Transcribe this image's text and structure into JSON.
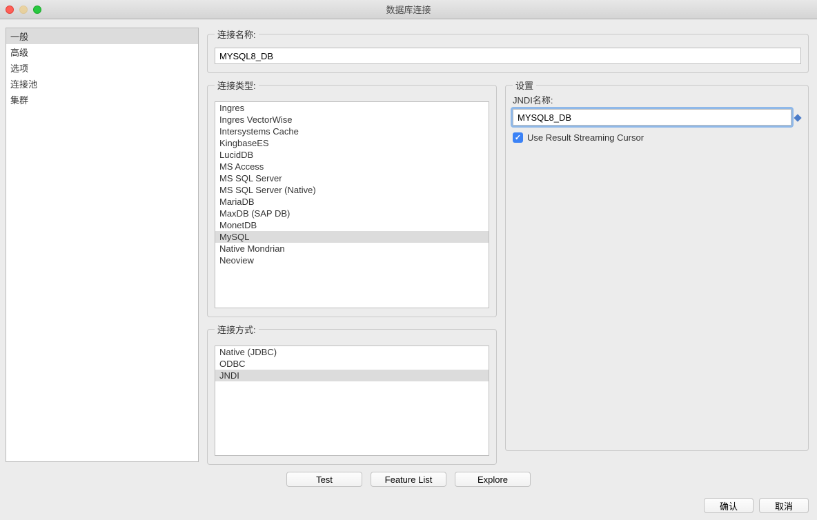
{
  "window": {
    "title": "数据库连接"
  },
  "sidebar": {
    "items": [
      {
        "label": "一般",
        "selected": true
      },
      {
        "label": "高级",
        "selected": false
      },
      {
        "label": "选项",
        "selected": false
      },
      {
        "label": "连接池",
        "selected": false
      },
      {
        "label": "集群",
        "selected": false
      }
    ]
  },
  "connName": {
    "legend": "连接名称:",
    "value": "MYSQL8_DB"
  },
  "connType": {
    "legend": "连接类型:",
    "items": [
      "Ingres",
      "Ingres VectorWise",
      "Intersystems Cache",
      "KingbaseES",
      "LucidDB",
      "MS Access",
      "MS SQL Server",
      "MS SQL Server (Native)",
      "MariaDB",
      "MaxDB (SAP DB)",
      "MonetDB",
      "MySQL",
      "Native Mondrian",
      "Neoview"
    ],
    "selected": "MySQL"
  },
  "connMethod": {
    "legend": "连接方式:",
    "items": [
      "Native (JDBC)",
      "ODBC",
      "JNDI"
    ],
    "selected": "JNDI"
  },
  "settings": {
    "legend": "设置",
    "jndiLabel": "JNDI名称:",
    "jndiValue": "MYSQL8_DB",
    "checkboxLabel": "Use Result Streaming Cursor",
    "checkboxChecked": true
  },
  "buttons": {
    "test": "Test",
    "featureList": "Feature List",
    "explore": "Explore",
    "ok": "确认",
    "cancel": "取消"
  }
}
